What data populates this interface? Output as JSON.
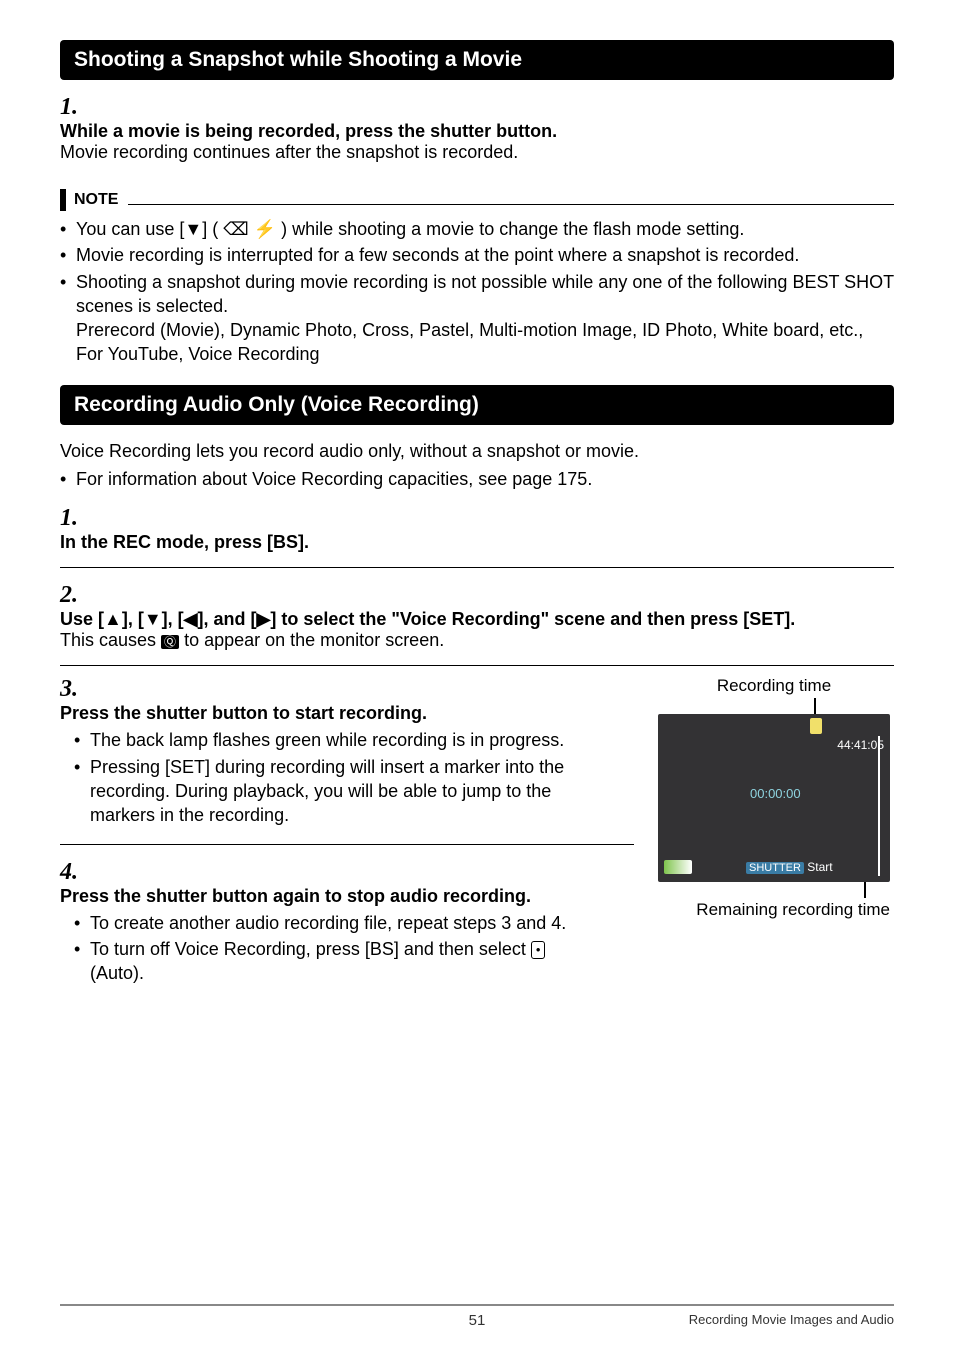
{
  "section1": {
    "title": "Shooting a Snapshot while Shooting a Movie"
  },
  "step1": {
    "num": "1.",
    "title": "While a movie is being recorded, press the shutter button.",
    "desc": "Movie recording continues after the snapshot is recorded."
  },
  "note": {
    "label": "NOTE",
    "items": [
      "You can use [▼] ( ⌫ ⚡ ) while shooting a movie to change the flash mode setting.",
      "Movie recording is interrupted for a few seconds at the point where a snapshot is recorded.",
      "Shooting a snapshot during movie recording is not possible while any one of the following BEST SHOT scenes is selected.\nPrerecord (Movie), Dynamic Photo, Cross, Pastel, Multi-motion Image, ID Photo, White board, etc., For YouTube, Voice Recording"
    ]
  },
  "section2": {
    "title": "Recording Audio Only (Voice Recording)"
  },
  "intro": {
    "line1": "Voice Recording lets you record audio only, without a snapshot or movie.",
    "bullet": "For information about Voice Recording capacities, see page 175."
  },
  "s2step1": {
    "num": "1.",
    "title": "In the REC mode, press [BS]."
  },
  "s2step2": {
    "num": "2.",
    "title_pre": "Use [",
    "title_mid": "], [",
    "title_post": "] to select the \"Voice Recording\" scene and then press [SET].",
    "arrows": [
      "▲",
      "▼",
      "◀",
      "▶"
    ],
    "desc_pre": "This causes ",
    "desc_post": " to appear on the monitor screen.",
    "icon": "🎤"
  },
  "s2step3": {
    "num": "3.",
    "title": "Press the shutter button to start recording.",
    "bullets": [
      "The back lamp flashes green while recording is in progress.",
      "Pressing [SET] during recording will insert a marker into the recording. During playback, you will be able to jump to the markers in the recording."
    ]
  },
  "s2step4": {
    "num": "4.",
    "title": "Press the shutter button again to stop audio recording.",
    "bullets": [
      "To create another audio recording file, repeat steps 3 and 4.",
      "To turn off Voice Recording, press [BS] and then select ⟨•⟩ (Auto)."
    ],
    "bullet2_pre": "To turn off Voice Recording, press [BS] and then select ",
    "bullet2_post": " (Auto)."
  },
  "preview": {
    "top_label": "Recording time",
    "total": "44:41:05",
    "elapsed": "00:00:00",
    "shutter_label": "SHUTTER",
    "start": "Start",
    "bottom_label": "Remaining recording time"
  },
  "footer": {
    "page": "51",
    "section": "Recording Movie Images and Audio"
  }
}
